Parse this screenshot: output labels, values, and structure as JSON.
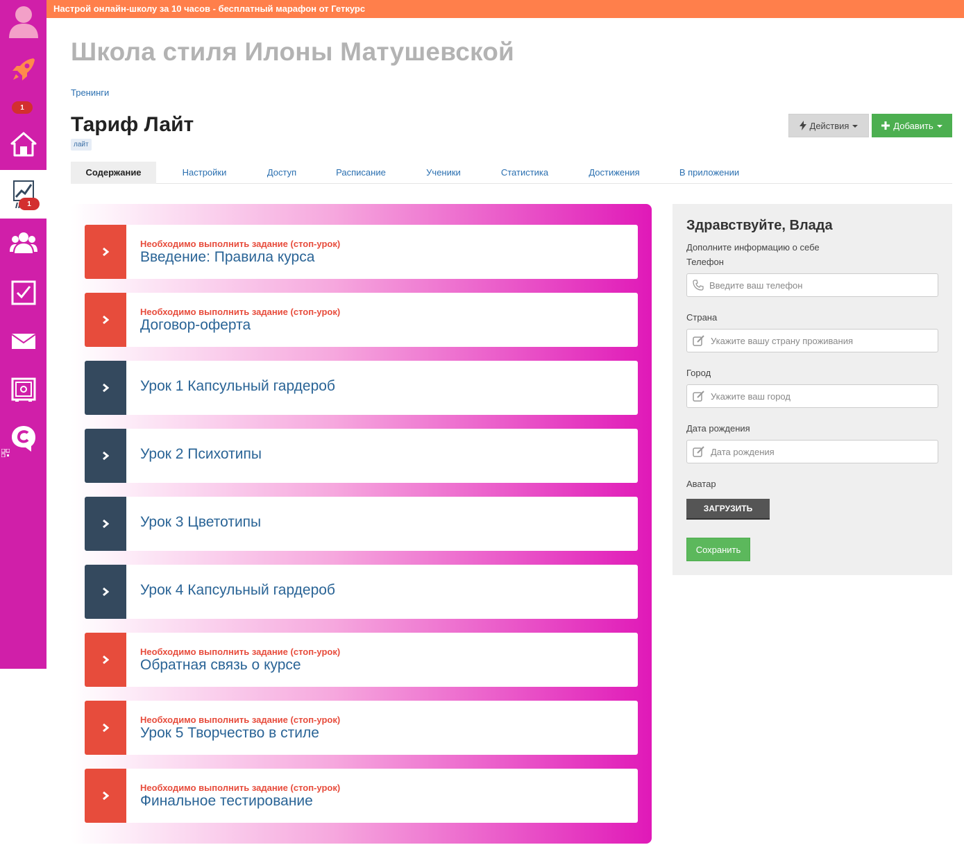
{
  "banner": {
    "text": "Настрой онлайн-школу за 10 часов - бесплатный марафон от Геткурс"
  },
  "header": {
    "school_title": "Школа стиля Илоны Матушевской",
    "breadcrumb": "Тренинги",
    "page_title": "Тариф Лайт",
    "tag": "лайт"
  },
  "toolbar": {
    "actions_label": "Действия",
    "add_label": "Добавить"
  },
  "sidebar": {
    "badges": {
      "notifications": "1",
      "stats": "1"
    },
    "icons": [
      "user-avatar-icon",
      "rocket-icon",
      "home-icon",
      "chart-icon",
      "users-icon",
      "tasks-icon",
      "mail-icon",
      "safe-icon",
      "chat-icon",
      "qr-icon"
    ]
  },
  "tabs": [
    "Содержание",
    "Настройки",
    "Доступ",
    "Расписание",
    "Ученики",
    "Статистика",
    "Достижения",
    "В приложении"
  ],
  "lessons": [
    {
      "warning": "Необходимо выполнить задание (стоп-урок)",
      "title": "Введение: Правила курса",
      "status": "stop"
    },
    {
      "warning": "Необходимо выполнить задание (стоп-урок)",
      "title": "Договор-оферта",
      "status": "stop"
    },
    {
      "warning": "",
      "title": "Урок 1 Капсульный гардероб",
      "status": "normal"
    },
    {
      "warning": "",
      "title": "Урок 2 Психотипы",
      "status": "normal"
    },
    {
      "warning": "",
      "title": "Урок 3 Цветотипы",
      "status": "normal"
    },
    {
      "warning": "",
      "title": "Урок 4 Капсульный гардероб",
      "status": "normal"
    },
    {
      "warning": "Необходимо выполнить задание (стоп-урок)",
      "title": "Обратная связь о курсе",
      "status": "stop"
    },
    {
      "warning": "Необходимо выполнить задание (стоп-урок)",
      "title": "Урок 5 Творчество в стиле",
      "status": "stop"
    },
    {
      "warning": "Необходимо выполнить задание (стоп-урок)",
      "title": "Финальное тестирование",
      "status": "stop"
    }
  ],
  "profile": {
    "greeting": "Здравствуйте, Влада",
    "subtitle": "Дополните информацию о себе",
    "phone_label": "Телефон",
    "phone_placeholder": "Введите ваш телефон",
    "country_label": "Страна",
    "country_placeholder": "Укажите вашу страну проживания",
    "city_label": "Город",
    "city_placeholder": "Укажите ваш город",
    "birthday_label": "Дата рождения",
    "birthday_placeholder": "Дата рождения",
    "avatar_label": "Аватар",
    "upload_label": "ЗАГРУЗИТЬ",
    "save_label": "Сохранить"
  },
  "colors": {
    "sidebar": "#d01fa9",
    "banner": "#ff7f4b",
    "stop_lesson": "#e74c3c",
    "normal_lesson": "#34495e",
    "add_button": "#4caf50",
    "link": "#2a6fb0"
  }
}
